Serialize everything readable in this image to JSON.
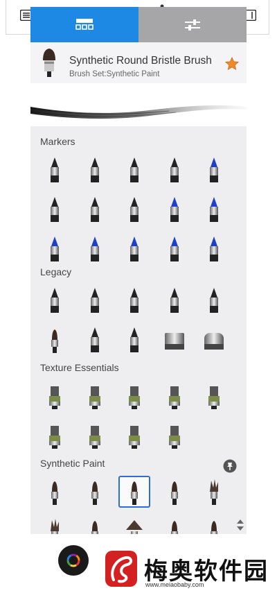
{
  "tabs": [
    {
      "name": "brush-library",
      "icon": "grid-icon",
      "active": true
    },
    {
      "name": "brush-properties",
      "icon": "sliders-icon",
      "active": false
    }
  ],
  "current_brush": {
    "title": "Synthetic Round Bristle Brush",
    "set": "Brush Set:Synthetic Paint",
    "favorite": true
  },
  "sections": [
    {
      "title": "Markers",
      "rows": [
        [
          "felt-pen",
          "felt-pen",
          "felt-pen",
          "ink-pen",
          "blue-pen"
        ],
        [
          "cone-marker",
          "cone-marker",
          "cone-marker",
          "cone-marker-blue",
          "cone-marker-blue"
        ],
        [
          "marker-cap",
          "marker-cap",
          "marker-cap",
          "block-marker",
          "chisel-marker"
        ]
      ]
    },
    {
      "title": "Legacy",
      "rows": [
        [
          "pencil",
          "airbrush",
          "chisel-highlighter",
          "chisel-tip",
          "technical-pen"
        ],
        [
          "round-brush",
          "ballpoint",
          "nib-pen",
          "eraser",
          "soft-eraser"
        ]
      ]
    },
    {
      "title": "Texture Essentials",
      "rows": [
        [
          "texture-a",
          "texture-b",
          "texture-c",
          "texture-d",
          "texture-e"
        ],
        [
          "texture-f",
          "texture-g",
          "texture-h",
          "texture-i"
        ]
      ]
    },
    {
      "title": "Synthetic Paint",
      "rows": [
        [
          "round-small",
          "round-bristle",
          "round-flat-selected",
          "round-thin",
          "spiky-bristle"
        ],
        [
          "spiky",
          "thin",
          "fan",
          "thin",
          "thin"
        ]
      ]
    }
  ],
  "colors": {
    "accent": "#1e88e5",
    "tab_inactive": "#a6a6a8",
    "star": "#f08a24",
    "selected": "#2a6fd6"
  },
  "watermark": {
    "title": "梅奥软件园",
    "url": "www.meiaobaby.com"
  }
}
